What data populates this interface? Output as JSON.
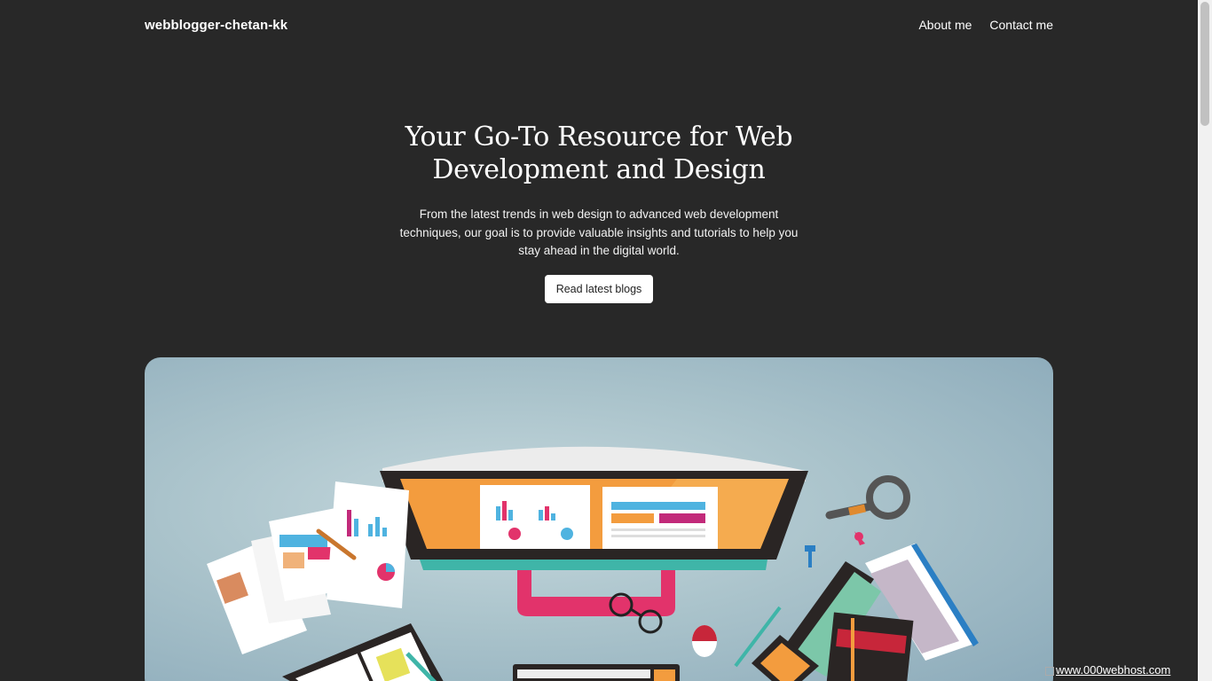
{
  "nav": {
    "brand": "webblogger-chetan-kk",
    "links": [
      "About me",
      "Contact me"
    ]
  },
  "hero": {
    "title": "Your Go-To Resource for Web Development and Design",
    "subtitle": "From the latest trends in web design to advanced web development techniques, our goal is to provide valuable insights and tutorials to help you stay ahead in the digital world.",
    "cta": "Read latest blogs"
  },
  "hero_image": {
    "subject": "flat illustration of a desk with monitor, charts, documents and office supplies"
  },
  "badge": {
    "text": "www.000webhost.com"
  },
  "colors": {
    "background": "#282828",
    "button_bg": "#ffffff",
    "button_text": "#222222",
    "monitor_screen": "#f39c3e",
    "accent_pink": "#e2336b",
    "accent_teal": "#3fb5a8"
  }
}
